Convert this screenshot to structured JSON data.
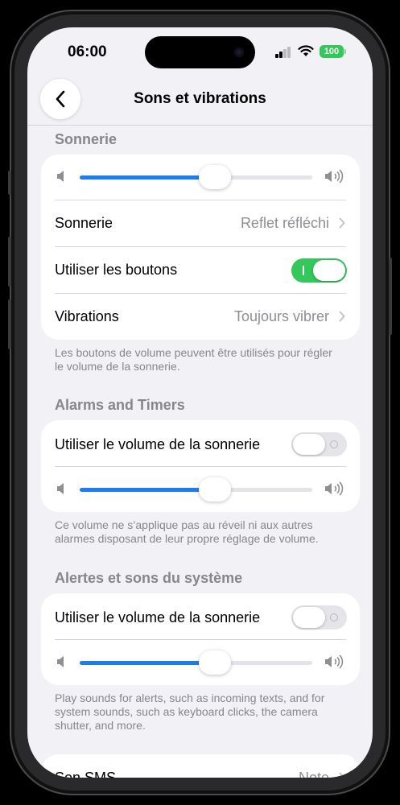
{
  "status_bar": {
    "time": "06:00",
    "battery": "100"
  },
  "header": {
    "title": "Sons et vibrations"
  },
  "sections": {
    "ringtone": {
      "title": "Sonnerie",
      "volume_level": 0.58,
      "ringtone_label": "Sonnerie",
      "ringtone_value": "Reflet réfléchi",
      "buttons_label": "Utiliser les boutons",
      "buttons_on": true,
      "vibrations_label": "Vibrations",
      "vibrations_value": "Toujours vibrer",
      "footnote": "Les boutons de volume peuvent être utilisés pour régler le volume de la sonnerie."
    },
    "alarms": {
      "title": "Alarms and Timers",
      "use_ringer_label": "Utiliser le volume de la sonnerie",
      "use_ringer_on": false,
      "volume_level": 0.58,
      "footnote": "Ce volume ne s’applique pas au réveil ni aux autres alarmes disposant de leur propre réglage de volume."
    },
    "system": {
      "title": "Alertes et sons du système",
      "use_ringer_label": "Utiliser le volume de la sonnerie",
      "use_ringer_on": false,
      "volume_level": 0.58,
      "footnote": "Play sounds for alerts, such as incoming texts, and for system sounds, such as keyboard clicks, the camera shutter, and more."
    },
    "sms": {
      "label": "Son SMS",
      "value": "Note"
    }
  },
  "colors": {
    "accent": "#1c7cf3",
    "toggle_on": "#34c759",
    "background": "#f2f1f6"
  }
}
